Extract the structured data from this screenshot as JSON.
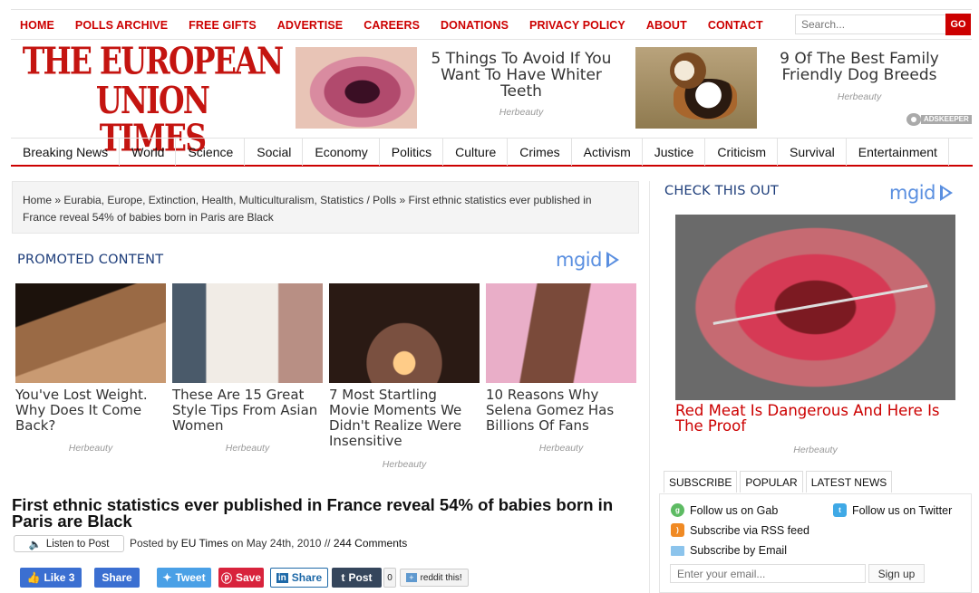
{
  "top_nav": [
    "HOME",
    "POLLS ARCHIVE",
    "FREE GIFTS",
    "ADVERTISE",
    "CAREERS",
    "DONATIONS",
    "PRIVACY POLICY",
    "ABOUT",
    "CONTACT"
  ],
  "search": {
    "placeholder": "Search...",
    "button": "GO"
  },
  "logo": {
    "line1": "THE EUROPEAN UNION",
    "line2": "TIMES"
  },
  "header_ads": [
    {
      "title": "5 Things To Avoid If You Want To Have Whiter Teeth",
      "source": "Herbeauty"
    },
    {
      "title": "9 Of The Best Family Friendly Dog Breeds",
      "source": "Herbeauty"
    }
  ],
  "adkeeper": "ADSKEEPER",
  "main_nav": [
    "Breaking News",
    "World",
    "Science",
    "Social",
    "Economy",
    "Politics",
    "Culture",
    "Crimes",
    "Activism",
    "Justice",
    "Criticism",
    "Survival",
    "Entertainment"
  ],
  "breadcrumb": "Home » Eurabia, Europe, Extinction, Health, Multiculturalism, Statistics / Polls » First ethnic statistics ever published in France reveal 54% of babies born in Paris are Black",
  "promoted": {
    "header": "PROMOTED CONTENT",
    "brand": "mgid",
    "items": [
      {
        "title": "You've Lost Weight. Why Does It Come Back?",
        "source": "Herbeauty"
      },
      {
        "title": "These Are 15 Great Style Tips From Asian Women",
        "source": "Herbeauty"
      },
      {
        "title": "7 Most Startling Movie Moments We Didn't Realize Were Insensitive",
        "source": "Herbeauty"
      },
      {
        "title": "10 Reasons Why Selena Gomez Has Billions Of Fans",
        "source": "Herbeauty"
      }
    ]
  },
  "article": {
    "title": "First ethnic statistics ever published in France reveal 54% of babies born in Paris are Black",
    "listen": "Listen to Post",
    "posted_prefix": "Posted by",
    "author": "EU Times",
    "date_text": "on May 24th, 2010 //",
    "comments": "244 Comments"
  },
  "share": {
    "fb_like": "Like 3",
    "fb_share": "Share",
    "tweet": "Tweet",
    "pin": "Save",
    "linkedin": "Share",
    "tumblr": "Post",
    "tumblr_count": "0",
    "reddit": "reddit this!"
  },
  "sidebar": {
    "header": "CHECK THIS OUT",
    "brand": "mgid",
    "ad_title": "Red Meat Is Dangerous And Here Is The Proof",
    "ad_source": "Herbeauty",
    "tabs": [
      "SUBSCRIBE",
      "POPULAR",
      "LATEST NEWS"
    ],
    "follow_gab": "Follow us on Gab",
    "follow_twitter": "Follow us on Twitter",
    "rss": "Subscribe via RSS feed",
    "email_sub": "Subscribe by Email",
    "email_placeholder": "Enter your email...",
    "signup": "Sign up"
  },
  "colors": {
    "brand_red": "#c41410",
    "link_red": "#cc0000",
    "section_blue": "#1d3d7a",
    "mgid_blue": "#5a8fe0"
  }
}
